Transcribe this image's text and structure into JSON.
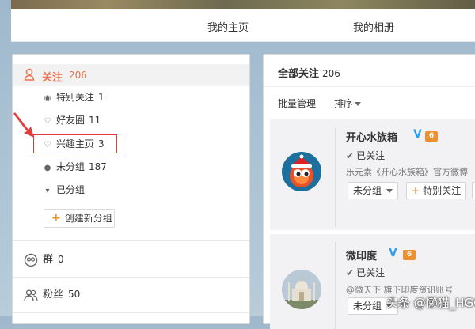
{
  "profile_nav": {
    "home": "我的主页",
    "album": "我的相册"
  },
  "sidebar": {
    "follow": {
      "label": "关注",
      "count": "206"
    },
    "sub_items": [
      {
        "label": "特别关注",
        "count": "1",
        "icon": "target-icon"
      },
      {
        "label": "好友圈",
        "count": "11",
        "icon": "heart-circle-icon"
      },
      {
        "label": "兴趣主页",
        "count": "3",
        "icon": "heart-plus-icon"
      },
      {
        "label": "未分组",
        "count": "187",
        "icon": "dot-icon"
      },
      {
        "label": "已分组",
        "count": "",
        "icon": "caret-down-icon"
      }
    ],
    "create_group": "创建新分组",
    "groups": {
      "label": "群",
      "count": "0"
    },
    "fans": {
      "label": "粉丝",
      "count": "50"
    }
  },
  "right_panel": {
    "title": "全部关注",
    "count": "206",
    "batch_manage": "批量管理",
    "sort": "排序",
    "cards": [
      {
        "name": "开心水族箱",
        "verified": "V",
        "level": "6",
        "followed": "已关注",
        "desc": "乐元素《开心水族箱》官方微博",
        "group_btn": "未分组",
        "special_btn": "特别关注"
      },
      {
        "name": "微印度",
        "verified": "V",
        "level": "6",
        "followed": "已关注",
        "desc": "@微天下 旗下印度资讯账号",
        "group_btn": "未分组",
        "special_btn": ""
      }
    ]
  },
  "watermark": "头条 @懒猫_HGO",
  "colors": {
    "accent": "#eb7350",
    "verified": "#2fa0ef",
    "highlight": "#e23d3d"
  }
}
